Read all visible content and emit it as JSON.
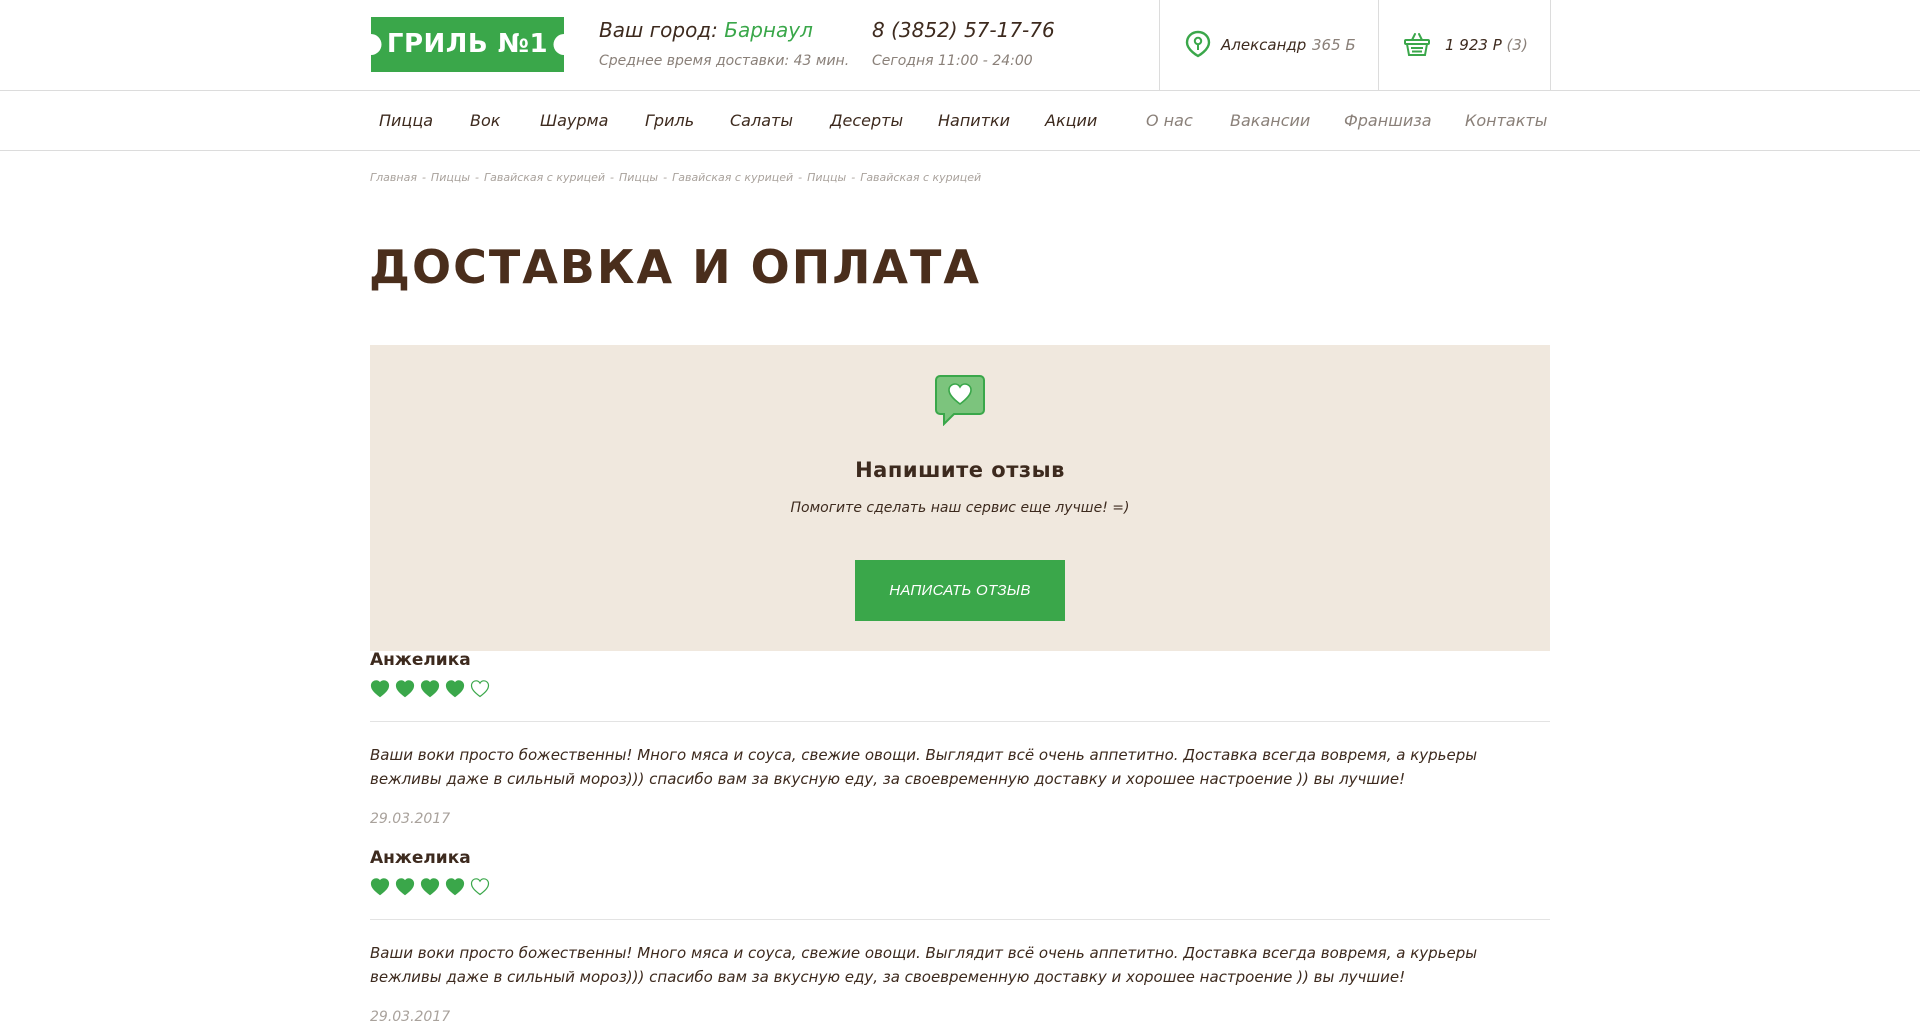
{
  "brand": {
    "logo_text": "ГРИЛЬ №1",
    "accent": "#3aa74a",
    "dark": "#3d2a1e",
    "panel_bg": "#f0e8de"
  },
  "header": {
    "city_label": "Ваш город:",
    "city_name": "Барнаул",
    "delivery_time": "Среднее время доставки: 43 мин.",
    "phone": "8 (3852) 57-17-76",
    "hours": "Сегодня 11:00 - 24:00",
    "user_name": "Александр",
    "user_points": "365 Б",
    "cart_total": "1 923 Р",
    "cart_count": "(3)"
  },
  "nav": {
    "primary": [
      "Пицца",
      "Вок",
      "Шаурма",
      "Гриль",
      "Салаты",
      "Десерты",
      "Напитки",
      "Акции"
    ],
    "secondary": [
      "О нас",
      "Вакансии",
      "Франшиза",
      "Контакты"
    ]
  },
  "breadcrumb": [
    "Главная",
    "Пиццы",
    "Гавайская с курицей",
    "Пиццы",
    "Гавайская с курицей",
    "Пиццы",
    "Гавайская с курицей"
  ],
  "page_title": "ДОСТАВКА И ОПЛАТА",
  "review_cta": {
    "title": "Напишите отзыв",
    "subtitle": "Помогите сделать наш сервис еще лучше! =)",
    "button": "НАПИСАТЬ ОТЗЫВ"
  },
  "reviews": [
    {
      "author": "Анжелика",
      "rating": 4,
      "rating_max": 5,
      "text": "Ваши воки просто божественны! Много мяса и соуса, свежие овощи. Выглядит всё очень аппетитно. Доставка всегда вовремя, а курьеры вежливы даже в сильный мороз))) спасибо вам за вкусную еду, за своевременную доставку и хорошее настроение )) вы лучшие!",
      "date": "29.03.2017"
    },
    {
      "author": "Анжелика",
      "rating": 4,
      "rating_max": 5,
      "text": "Ваши воки просто божественны! Много мяса и соуса, свежие овощи. Выглядит всё очень аппетитно. Доставка всегда вовремя, а курьеры вежливы даже в сильный мороз))) спасибо вам за вкусную еду, за своевременную доставку и хорошее настроение )) вы лучшие!",
      "date": "29.03.2017"
    }
  ]
}
